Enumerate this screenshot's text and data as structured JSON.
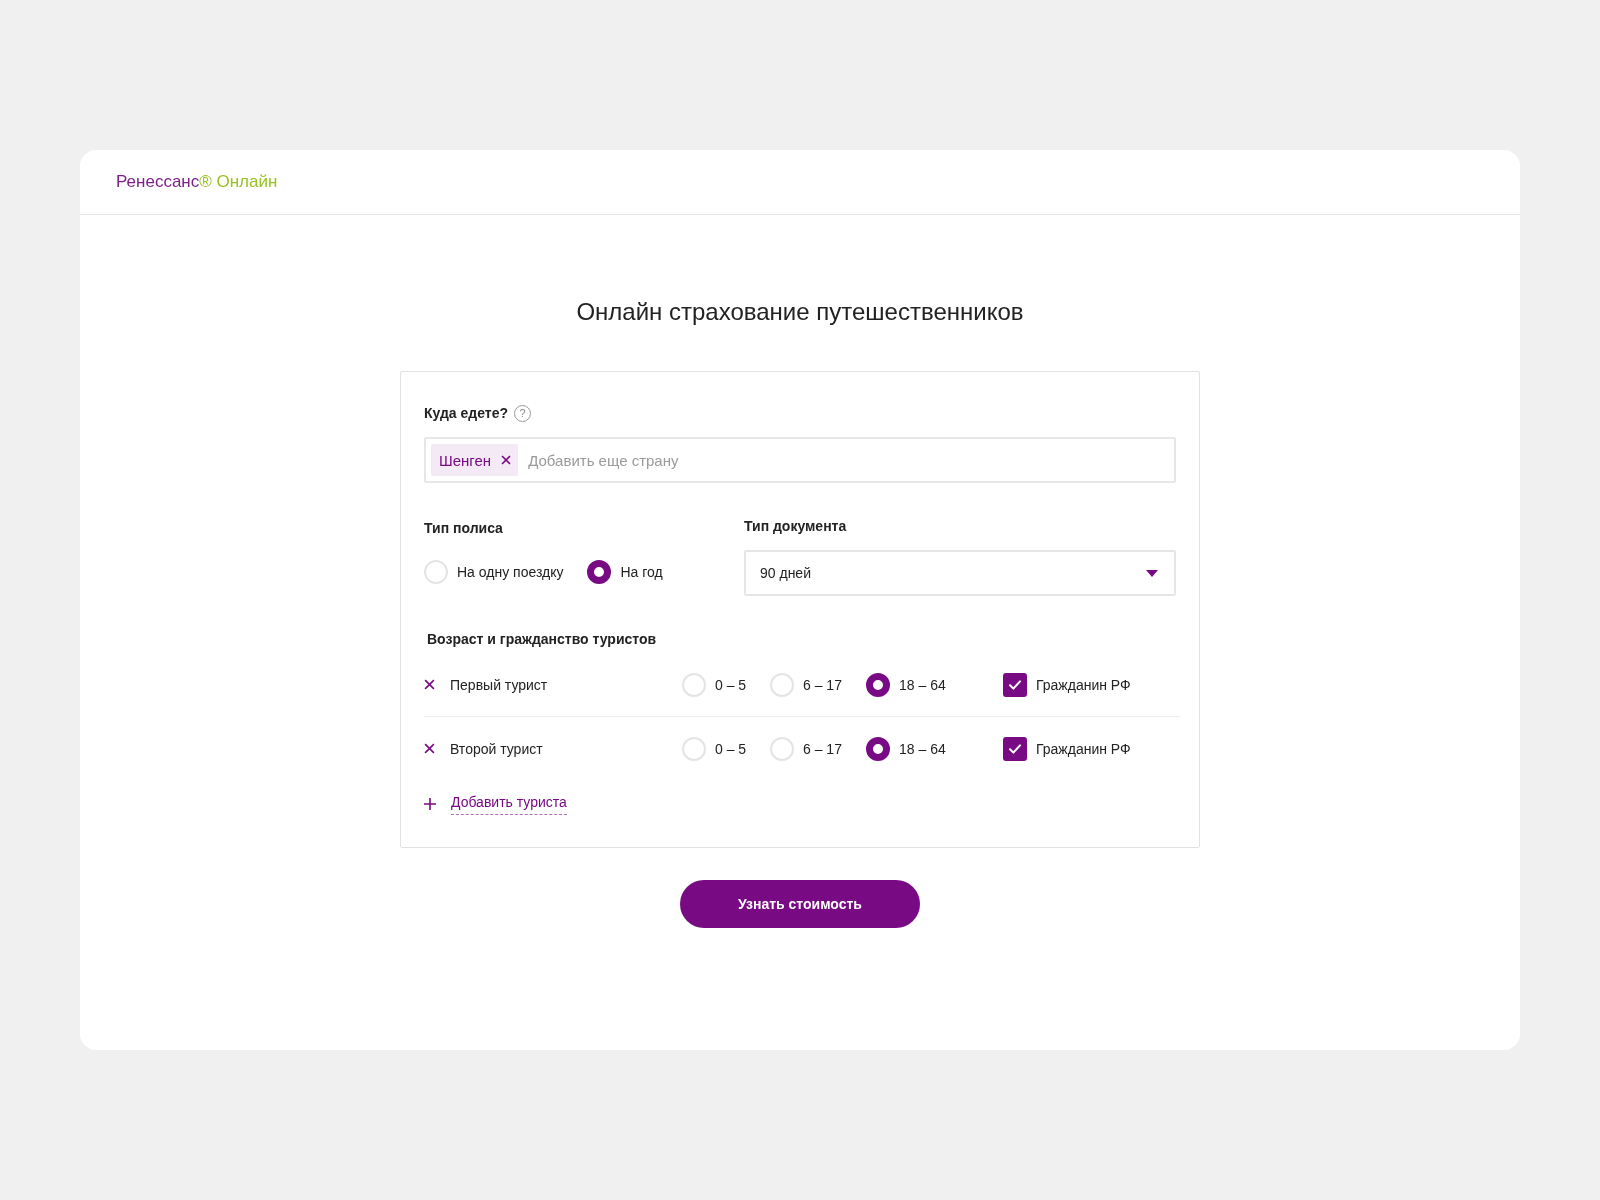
{
  "header": {
    "logo": {
      "name": "Ренессанс",
      "mark": "®",
      "product": "Онлайн"
    }
  },
  "title": "Онлайн страхование путешественников",
  "form": {
    "destination": {
      "label": "Куда едете?",
      "help_icon": "?",
      "tags": [
        {
          "label": "Шенген"
        }
      ],
      "placeholder": "Добавить еще страну"
    },
    "policy_type": {
      "label": "Тип полиса",
      "options": [
        {
          "label": "На одну поездку",
          "selected": false
        },
        {
          "label": "На год",
          "selected": true
        }
      ]
    },
    "document_type": {
      "label": "Тип документа",
      "value": "90 дней"
    },
    "tourists": {
      "label": "Возраст и гражданство туристов",
      "rows": [
        {
          "name": "Первый турист",
          "age_options": [
            {
              "label": "0 – 5",
              "selected": false
            },
            {
              "label": "6 – 17",
              "selected": false
            },
            {
              "label": "18 – 64",
              "selected": true
            }
          ],
          "citizen": {
            "label": "Гражданин РФ",
            "checked": true
          }
        },
        {
          "name": "Второй турист",
          "age_options": [
            {
              "label": "0 – 5",
              "selected": false
            },
            {
              "label": "6 – 17",
              "selected": false
            },
            {
              "label": "18 – 64",
              "selected": true
            }
          ],
          "citizen": {
            "label": "Гражданин РФ",
            "checked": true
          }
        }
      ],
      "add_link": "Добавить туриста"
    }
  },
  "submit_button": "Узнать стоимость"
}
